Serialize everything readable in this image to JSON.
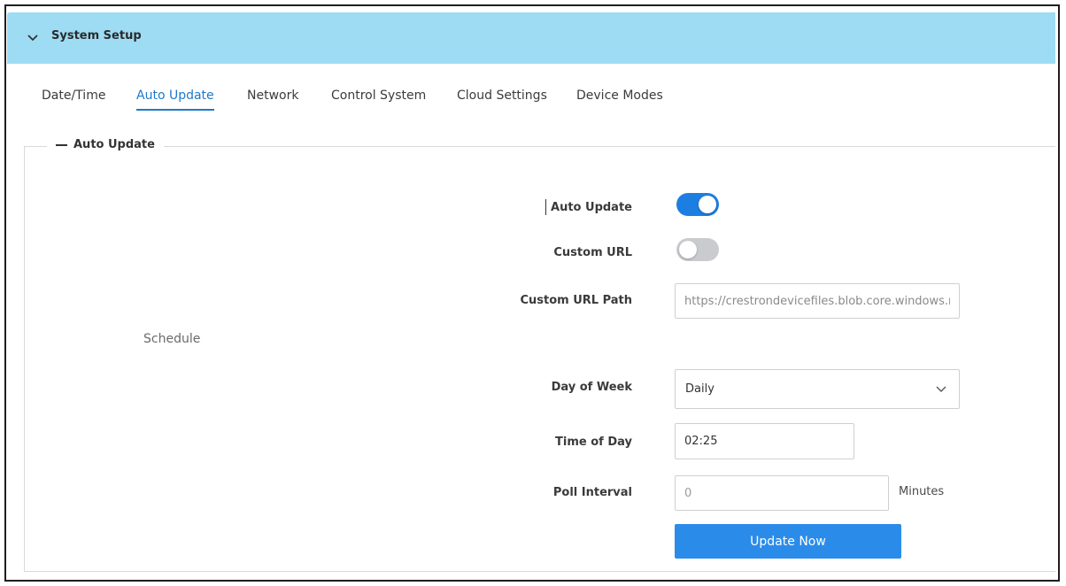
{
  "panel": {
    "title": "System Setup"
  },
  "tabs": [
    {
      "label": "Date/Time",
      "active": false
    },
    {
      "label": "Auto Update",
      "active": true
    },
    {
      "label": "Network",
      "active": false
    },
    {
      "label": "Control System",
      "active": false
    },
    {
      "label": "Cloud Settings",
      "active": false
    },
    {
      "label": "Device Modes",
      "active": false
    }
  ],
  "section": {
    "legend": "Auto Update",
    "schedule_label": "Schedule"
  },
  "form": {
    "auto_update": {
      "label": "Auto Update",
      "enabled": true
    },
    "custom_url": {
      "label": "Custom URL",
      "enabled": false
    },
    "custom_url_path": {
      "label": "Custom URL Path",
      "value": "https://crestrondevicefiles.blob.core.windows.net/"
    },
    "day_of_week": {
      "label": "Day of Week",
      "value": "Daily"
    },
    "time_of_day": {
      "label": "Time of Day",
      "value": "02:25"
    },
    "poll_interval": {
      "label": "Poll Interval",
      "placeholder": "0",
      "unit": "Minutes"
    },
    "update_now": {
      "label": "Update Now"
    }
  },
  "colors": {
    "header_bg": "#9edcf4",
    "accent": "#1f79c9",
    "toggle_on": "#1d7ee2",
    "button": "#2b8be9"
  }
}
